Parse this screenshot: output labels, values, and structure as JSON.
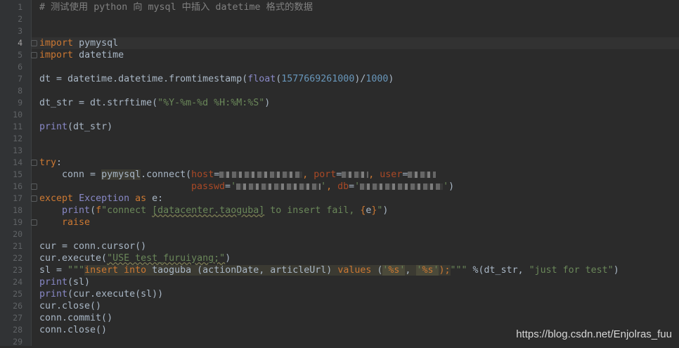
{
  "editor": {
    "language": "python",
    "active_line": "4",
    "line_numbers": [
      "1",
      "2",
      "3",
      "4",
      "5",
      "6",
      "7",
      "8",
      "9",
      "10",
      "11",
      "12",
      "13",
      "14",
      "15",
      "16",
      "17",
      "18",
      "19",
      "20",
      "21",
      "22",
      "23",
      "24",
      "25",
      "26",
      "27",
      "28",
      "29"
    ],
    "code": {
      "l1": "# 测试使用 python 向 mysql 中插入 datetime 格式的数据",
      "l4_kw": "import",
      "l4_mod": "pymysql",
      "l5_kw": "import",
      "l5_mod": "datetime",
      "l7_a": "dt = datetime.datetime.fromtimestamp(",
      "l7_fn": "float",
      "l7_b": "(",
      "l7_num1": "1577669261000",
      "l7_c": ")/",
      "l7_num2": "1000",
      "l7_d": ")",
      "l9_a": "dt_str = dt.strftime(",
      "l9_str": "\"%Y-%m-%d %H:%M:%S\"",
      "l9_b": ")",
      "l11_fn": "print",
      "l11_a": "(dt_str)",
      "l14_kw": "try",
      "l14_a": ":",
      "l15_a": "    conn = ",
      "l15_b": "pymysql",
      "l15_c": ".connect(",
      "l15_p1": "host",
      "l15_eq1": "=",
      "l15_p2": "port",
      "l15_eq2": "=",
      "l15_p3": "user",
      "l15_eq3": "=",
      "l16_p1": "passwd",
      "l16_eq1": "=",
      "l16_s1": "'",
      "l16_s2": "'",
      "l16_p2": "db",
      "l16_eq2": "=",
      "l16_s3": "'",
      "l16_s4": "'",
      "l16_end": ")",
      "l17_kw1": "except",
      "l17_cls": "Exception",
      "l17_kw2": "as",
      "l17_a": "e:",
      "l18_fn": "print",
      "l18_a": "(",
      "l18_f": "f",
      "l18_s1": "\"connect ",
      "l18_s2": "[datacenter.taoguba]",
      "l18_s3": " to insert fail, ",
      "l18_b1": "{",
      "l18_e": "e",
      "l18_b2": "}",
      "l18_s4": "\"",
      "l18_end": ")",
      "l19_kw": "raise",
      "l21_a": "cur = conn.cursor()",
      "l22_a": "cur.execute(",
      "l22_s": "\"USE test_furuiyang;\"",
      "l22_b": ")",
      "l23_a": "sl = ",
      "l23_q1": "\"\"\"",
      "l23_kw1": "insert into",
      "l23_b": " taoguba (actionDate, articleUrl) ",
      "l23_kw2": "values",
      "l23_c": " (",
      "l23_s1": "'",
      "l23_f1": "%s",
      "l23_s2": "'",
      "l23_d": ", ",
      "l23_s3": "'",
      "l23_f2": "%s",
      "l23_s4": "'",
      "l23_e": ");",
      "l23_q2": "\"\"\"",
      "l23_g": " %(dt_str, ",
      "l23_str": "\"just for test\"",
      "l23_h": ")",
      "l24_fn": "print",
      "l24_a": "(sl)",
      "l25_fn": "print",
      "l25_a": "(cur.execute(sl))",
      "l26_a": "cur.close()",
      "l27_a": "conn.commit()",
      "l28_a": "conn.close()"
    }
  },
  "watermark": "https://blog.csdn.net/Enjolras_fuu",
  "colors": {
    "background": "#2b2b2b",
    "keyword": "#cc7832",
    "string": "#6a8759",
    "number": "#6897bb",
    "builtin": "#8888c6",
    "param": "#aa4926",
    "comment": "#808080",
    "text": "#a9b7c6"
  }
}
